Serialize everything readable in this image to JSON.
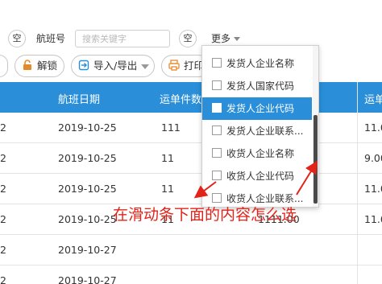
{
  "filter": {
    "empty_label_1": "空",
    "flight_label": "航班号",
    "search_placeholder": "搜索关键字",
    "empty_label_2": "空",
    "more_label": "更多"
  },
  "toolbar": {
    "unlock_label": "解锁",
    "import_export_label": "导入/导出",
    "print_label": "打印"
  },
  "table": {
    "headers": [
      "航班日期",
      "运单件数",
      "运单"
    ],
    "rows": [
      {
        "lead": "2",
        "date": "2019-10-25",
        "pieces": "111",
        "amount": "",
        "right": "11.0"
      },
      {
        "lead": "2",
        "date": "2019-10-25",
        "pieces": "11",
        "amount": "",
        "right": "9.00"
      },
      {
        "lead": "2",
        "date": "2019-10-25",
        "pieces": "11",
        "amount": "",
        "right": "11.0"
      },
      {
        "lead": "2",
        "date": "2019-10-25",
        "pieces": "11",
        "amount": "1111.00",
        "right": "11.0"
      },
      {
        "lead": "2",
        "date": "2019-10-27",
        "pieces": "",
        "amount": "",
        "right": ""
      },
      {
        "lead": "2",
        "date": "2019-10-27",
        "pieces": "",
        "amount": "",
        "right": ""
      }
    ]
  },
  "dropdown": {
    "items": [
      {
        "label": "发货人企业名称",
        "highlighted": false
      },
      {
        "label": "发货人国家代码",
        "highlighted": false
      },
      {
        "label": "发货人企业代码",
        "highlighted": true
      },
      {
        "label": "发货人企业联系...",
        "highlighted": false
      },
      {
        "label": "收货人企业名称",
        "highlighted": false
      },
      {
        "label": "收货人企业代码",
        "highlighted": false
      },
      {
        "label": "收货人企业联系...",
        "highlighted": false
      }
    ]
  },
  "annotation": {
    "text": "在滑动条下面的内容怎么选",
    "color": "#e2231a"
  },
  "colors": {
    "accent": "#2a8fd8",
    "annotation": "#e2231a"
  }
}
